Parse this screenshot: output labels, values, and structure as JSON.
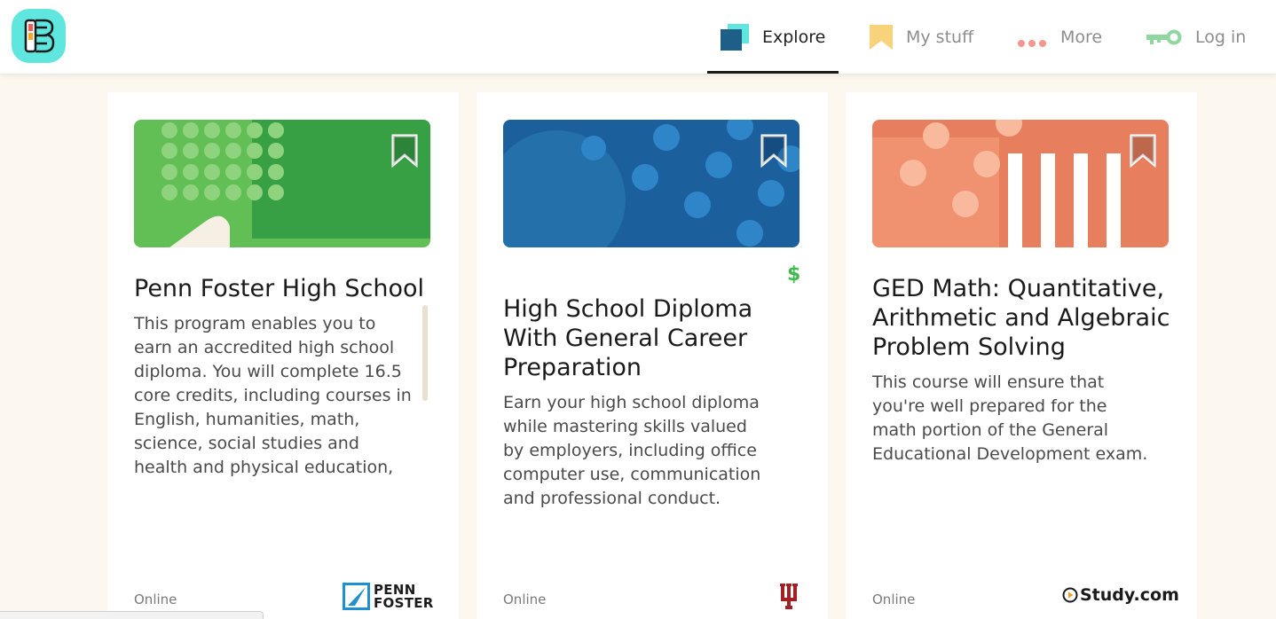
{
  "colors": {
    "page_background": "#fcf7ef",
    "logo_background": "#5ee6df",
    "price_green": "#3dbb4f"
  },
  "nav": {
    "explore": "Explore",
    "my_stuff": "My stuff",
    "more": "More",
    "login": "Log in",
    "active": "Explore"
  },
  "cards": [
    {
      "title": "Penn Foster High School",
      "description": "This program enables you to earn an accredited high school diploma. You will complete 16.5 core credits, including courses in English, humanities, math, science, social studies and health and physical education,",
      "delivery": "Online",
      "provider_logo": "penn-foster-logo",
      "provider_text": [
        "PENN",
        "FOSTER"
      ],
      "banner_color": "#3ea34a"
    },
    {
      "title": "High School Diploma With General Career Preparation",
      "description": "Earn your high school diploma while mastering skills valued by employers, including office computer use, communication and professional conduct.",
      "delivery": "Online",
      "price_icon": "$",
      "provider_logo": "indiana-university-logo",
      "banner_color": "#1b64a0"
    },
    {
      "title": "GED Math: Quantitative, Arithmetic and Algebraic Problem Solving",
      "description": "This course will ensure that you're well prepared for the math portion of the General Educational Development exam.",
      "delivery": "Online",
      "provider_logo": "study-com-logo",
      "provider_text": "Study.com",
      "banner_color": "#e88364"
    }
  ]
}
